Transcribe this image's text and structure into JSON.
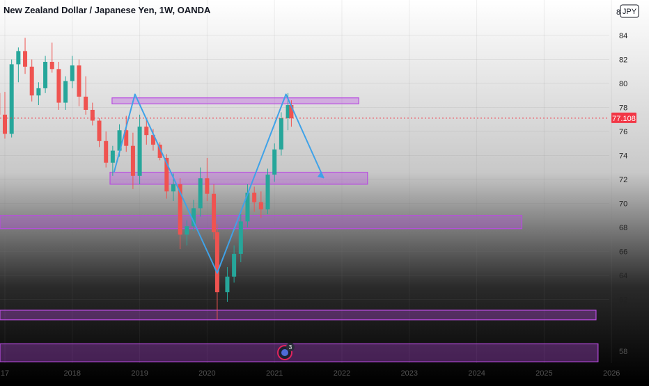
{
  "title": "New Zealand Dollar / Japanese Yen, 1W, OANDA",
  "currency_badge": "JPY",
  "top_price_partial": "8",
  "chart_data": {
    "type": "candlestick",
    "y_ticks": [
      "84",
      "82",
      "80",
      "78",
      "76",
      "74",
      "72",
      "70",
      "68",
      "66",
      "64",
      "62"
    ],
    "y_bottom_partial": "58",
    "x_ticks": [
      "17",
      "2018",
      "2019",
      "2020",
      "2021",
      "2022",
      "2023",
      "2024",
      "2025",
      "2026"
    ],
    "last_price": "77.108",
    "last_price_color": "#f23645",
    "ylim": [
      56.8,
      85.7
    ],
    "zones": [
      {
        "name": "resistance-zone",
        "x_from": 2018.59,
        "x_to": 2022.25,
        "y_from": 78.3,
        "y_to": 78.8
      },
      {
        "name": "neckline-zone",
        "x_from": 2018.56,
        "x_to": 2022.38,
        "y_from": 71.6,
        "y_to": 72.6
      },
      {
        "name": "demand-zone",
        "x_from": 2016.6,
        "x_to": 2024.67,
        "y_from": 67.9,
        "y_to": 69.0
      },
      {
        "name": "low-zone-1",
        "x_from": 2016.6,
        "x_to": 2025.77,
        "y_from": 60.3,
        "y_to": 61.1
      },
      {
        "name": "low-zone-2",
        "x_from": 2016.6,
        "x_to": 2025.8,
        "y_from": 56.8,
        "y_to": 58.3
      }
    ],
    "pattern_path": [
      [
        2018.62,
        72.6
      ],
      [
        2018.93,
        79.1
      ],
      [
        2020.15,
        64.2
      ],
      [
        2021.17,
        79.1
      ],
      [
        2021.73,
        72.1
      ]
    ],
    "pattern_color": "#3fa2e8",
    "zone_color": "#b84ce0",
    "up_color": "#26a69a",
    "down_color": "#ef5350",
    "ohlc": [
      [
        2016.6,
        79.5,
        83.9,
        79.0,
        83.2
      ],
      [
        2016.7,
        83.2,
        83.4,
        80.3,
        80.6
      ],
      [
        2016.8,
        80.6,
        82.1,
        78.2,
        79.2
      ],
      [
        2016.9,
        79.2,
        80.0,
        76.5,
        77.4
      ],
      [
        2017.0,
        77.4,
        79.3,
        75.4,
        75.8
      ],
      [
        2017.1,
        75.8,
        82.0,
        75.5,
        81.6
      ],
      [
        2017.2,
        81.6,
        83.0,
        80.1,
        82.7
      ],
      [
        2017.3,
        82.7,
        83.8,
        80.8,
        81.4
      ],
      [
        2017.4,
        81.4,
        82.0,
        78.5,
        79.0
      ],
      [
        2017.5,
        79.0,
        80.1,
        78.2,
        79.6
      ],
      [
        2017.6,
        79.6,
        82.3,
        79.2,
        81.8
      ],
      [
        2017.7,
        81.8,
        83.4,
        80.9,
        81.2
      ],
      [
        2017.8,
        81.2,
        81.8,
        77.8,
        78.4
      ],
      [
        2017.9,
        78.4,
        80.6,
        77.8,
        80.2
      ],
      [
        2018.0,
        80.2,
        82.3,
        79.6,
        81.5
      ],
      [
        2018.1,
        81.5,
        82.0,
        78.1,
        78.9
      ],
      [
        2018.2,
        78.9,
        80.6,
        77.4,
        77.8
      ],
      [
        2018.3,
        77.8,
        78.4,
        76.5,
        76.9
      ],
      [
        2018.4,
        76.9,
        77.1,
        74.7,
        75.2
      ],
      [
        2018.5,
        75.2,
        76.0,
        73.0,
        73.4
      ],
      [
        2018.6,
        73.4,
        74.8,
        72.3,
        74.4
      ],
      [
        2018.7,
        74.4,
        76.6,
        73.9,
        76.1
      ],
      [
        2018.8,
        76.1,
        77.3,
        74.3,
        74.8
      ],
      [
        2018.9,
        74.8,
        75.9,
        71.2,
        72.3
      ],
      [
        2019.0,
        72.3,
        77.4,
        71.6,
        76.4
      ],
      [
        2019.1,
        76.4,
        77.0,
        74.9,
        75.7
      ],
      [
        2019.2,
        75.7,
        76.2,
        74.4,
        74.9
      ],
      [
        2019.3,
        74.9,
        75.1,
        73.6,
        73.8
      ],
      [
        2019.4,
        73.8,
        74.1,
        70.4,
        71.0
      ],
      [
        2019.5,
        71.0,
        72.5,
        70.2,
        71.6
      ],
      [
        2019.6,
        71.6,
        72.1,
        66.2,
        67.4
      ],
      [
        2019.7,
        67.4,
        68.6,
        66.5,
        68.1
      ],
      [
        2019.8,
        68.1,
        70.3,
        67.7,
        69.6
      ],
      [
        2019.9,
        69.6,
        73.0,
        68.9,
        72.1
      ],
      [
        2020.0,
        72.1,
        73.8,
        70.2,
        70.8
      ],
      [
        2020.1,
        70.8,
        71.6,
        67.0,
        67.6
      ],
      [
        2020.15,
        67.6,
        68.3,
        60.3,
        62.6
      ],
      [
        2020.3,
        62.6,
        64.7,
        61.8,
        63.9
      ],
      [
        2020.4,
        63.9,
        66.5,
        63.4,
        65.8
      ],
      [
        2020.5,
        65.8,
        69.1,
        65.1,
        68.5
      ],
      [
        2020.6,
        68.5,
        71.6,
        68.0,
        70.9
      ],
      [
        2020.7,
        70.9,
        71.4,
        69.3,
        70.1
      ],
      [
        2020.8,
        70.1,
        71.0,
        68.8,
        69.5
      ],
      [
        2020.9,
        69.5,
        72.9,
        69.1,
        72.4
      ],
      [
        2021.0,
        72.4,
        75.0,
        71.8,
        74.5
      ],
      [
        2021.1,
        74.5,
        77.6,
        74.0,
        77.1
      ],
      [
        2021.2,
        77.1,
        79.2,
        76.1,
        78.2
      ],
      [
        2021.25,
        78.2,
        78.6,
        76.4,
        77.1
      ]
    ]
  }
}
